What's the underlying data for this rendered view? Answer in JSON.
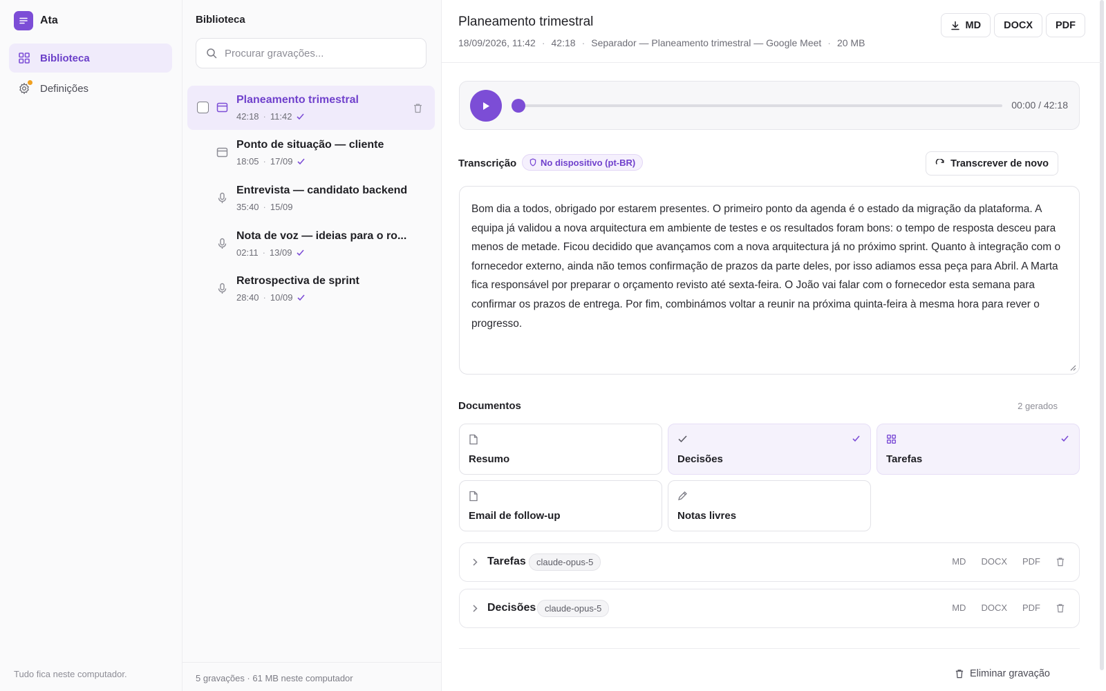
{
  "app": {
    "name": "Ata"
  },
  "nav": {
    "items": [
      {
        "label": "Biblioteca",
        "icon": "grid-icon",
        "active": true
      },
      {
        "label": "Definições",
        "icon": "gear-icon",
        "active": false
      }
    ],
    "footer": "Tudo fica neste computador."
  },
  "library": {
    "title": "Biblioteca",
    "search_placeholder": "Procurar gravações...",
    "recordings": [
      {
        "title": "Planeamento trimestral",
        "duration": "42:18",
        "date": "11:42",
        "type": "window-icon",
        "transcribed": true,
        "active": true
      },
      {
        "title": "Ponto de situação — cliente",
        "duration": "18:05",
        "date": "17/09",
        "type": "window-icon",
        "transcribed": true,
        "active": false
      },
      {
        "title": "Entrevista — candidato backend",
        "duration": "35:40",
        "date": "15/09",
        "type": "microphone-icon",
        "transcribed": false,
        "active": false
      },
      {
        "title": "Nota de voz — ideias para o ro...",
        "duration": "02:11",
        "date": "13/09",
        "type": "microphone-icon",
        "transcribed": true,
        "active": false
      },
      {
        "title": "Retrospectiva de sprint",
        "duration": "28:40",
        "date": "10/09",
        "type": "microphone-icon",
        "transcribed": true,
        "active": false
      }
    ],
    "footer": "5 gravações · 61 MB neste computador"
  },
  "detail": {
    "title": "Planeamento trimestral",
    "meta": {
      "datetime": "18/09/2026, 11:42",
      "duration": "42:18",
      "source": "Separador — Planeamento trimestral — Google Meet",
      "size": "20 MB",
      "separator": "·"
    },
    "export": {
      "md": "MD",
      "docx": "DOCX",
      "pdf": "PDF"
    },
    "player": {
      "time": "00:00 / 42:18",
      "progress": 0
    },
    "transcript": {
      "label": "Transcrição",
      "badge": "No dispositivo (pt-BR)",
      "retranscribe": "Transcrever de novo",
      "text": "Bom dia a todos, obrigado por estarem presentes. O primeiro ponto da agenda é o estado da migração da plataforma. A equipa já validou a nova arquitectura em ambiente de testes e os resultados foram bons: o tempo de resposta desceu para menos de metade. Ficou decidido que avançamos com a nova arquitectura já no próximo sprint. Quanto à integração com o fornecedor externo, ainda não temos confirmação de prazos da parte deles, por isso adiamos essa peça para Abril. A Marta fica responsável por preparar o orçamento revisto até sexta-feira. O João vai falar com o fornecedor esta semana para confirmar os prazos de entrega. Por fim, combinámos voltar a reunir na próxima quinta-feira à mesma hora para rever o progresso."
    },
    "documents": {
      "label": "Documentos",
      "count": "2 gerados",
      "cards": [
        {
          "label": "Resumo",
          "icon": "document-icon",
          "done": false
        },
        {
          "label": "Decisões",
          "icon": "check-icon",
          "done": true
        },
        {
          "label": "Tarefas",
          "icon": "grid-icon",
          "done": true
        },
        {
          "label": "Email de follow-up",
          "icon": "document-icon",
          "done": false
        },
        {
          "label": "Notas livres",
          "icon": "pencil-icon",
          "done": false
        }
      ],
      "generated": [
        {
          "label": "Tarefas",
          "model": "claude-opus-5",
          "md": "MD",
          "docx": "DOCX",
          "pdf": "PDF"
        },
        {
          "label": "Decisões",
          "model": "claude-opus-5",
          "md": "MD",
          "docx": "DOCX",
          "pdf": "PDF"
        }
      ]
    },
    "delete_label": "Eliminar gravação"
  },
  "colors": {
    "accent": "#7c4dd6",
    "accent_text": "#7041cc",
    "active_bg": "#f0ebfb",
    "notification": "#f0a020"
  }
}
